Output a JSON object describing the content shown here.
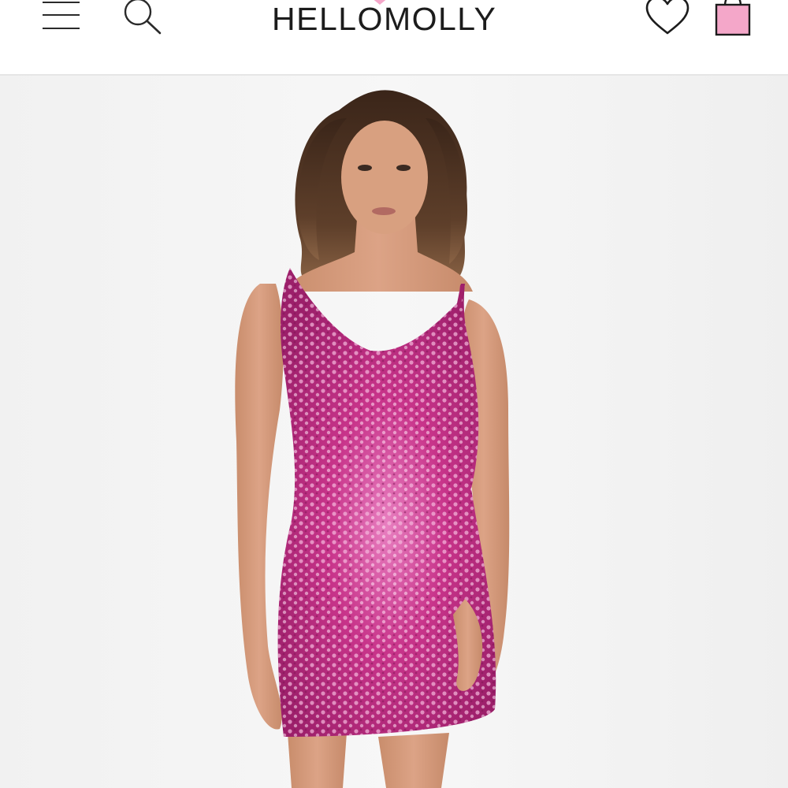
{
  "header": {
    "brand": "HELLOMOLLY",
    "menu_icon": "hamburger-menu-icon",
    "search_icon": "search-icon",
    "wishlist_icon": "heart-outline-icon",
    "cart_icon": "shopping-bag-icon"
  },
  "colors": {
    "brand_pink": "#f4a7c9",
    "text_dark": "#1c1c1c",
    "dress_pink": "#c2267e",
    "background": "#f4f4f4"
  },
  "product": {
    "image": "model-wearing-pink-sequin-mini-dress"
  }
}
